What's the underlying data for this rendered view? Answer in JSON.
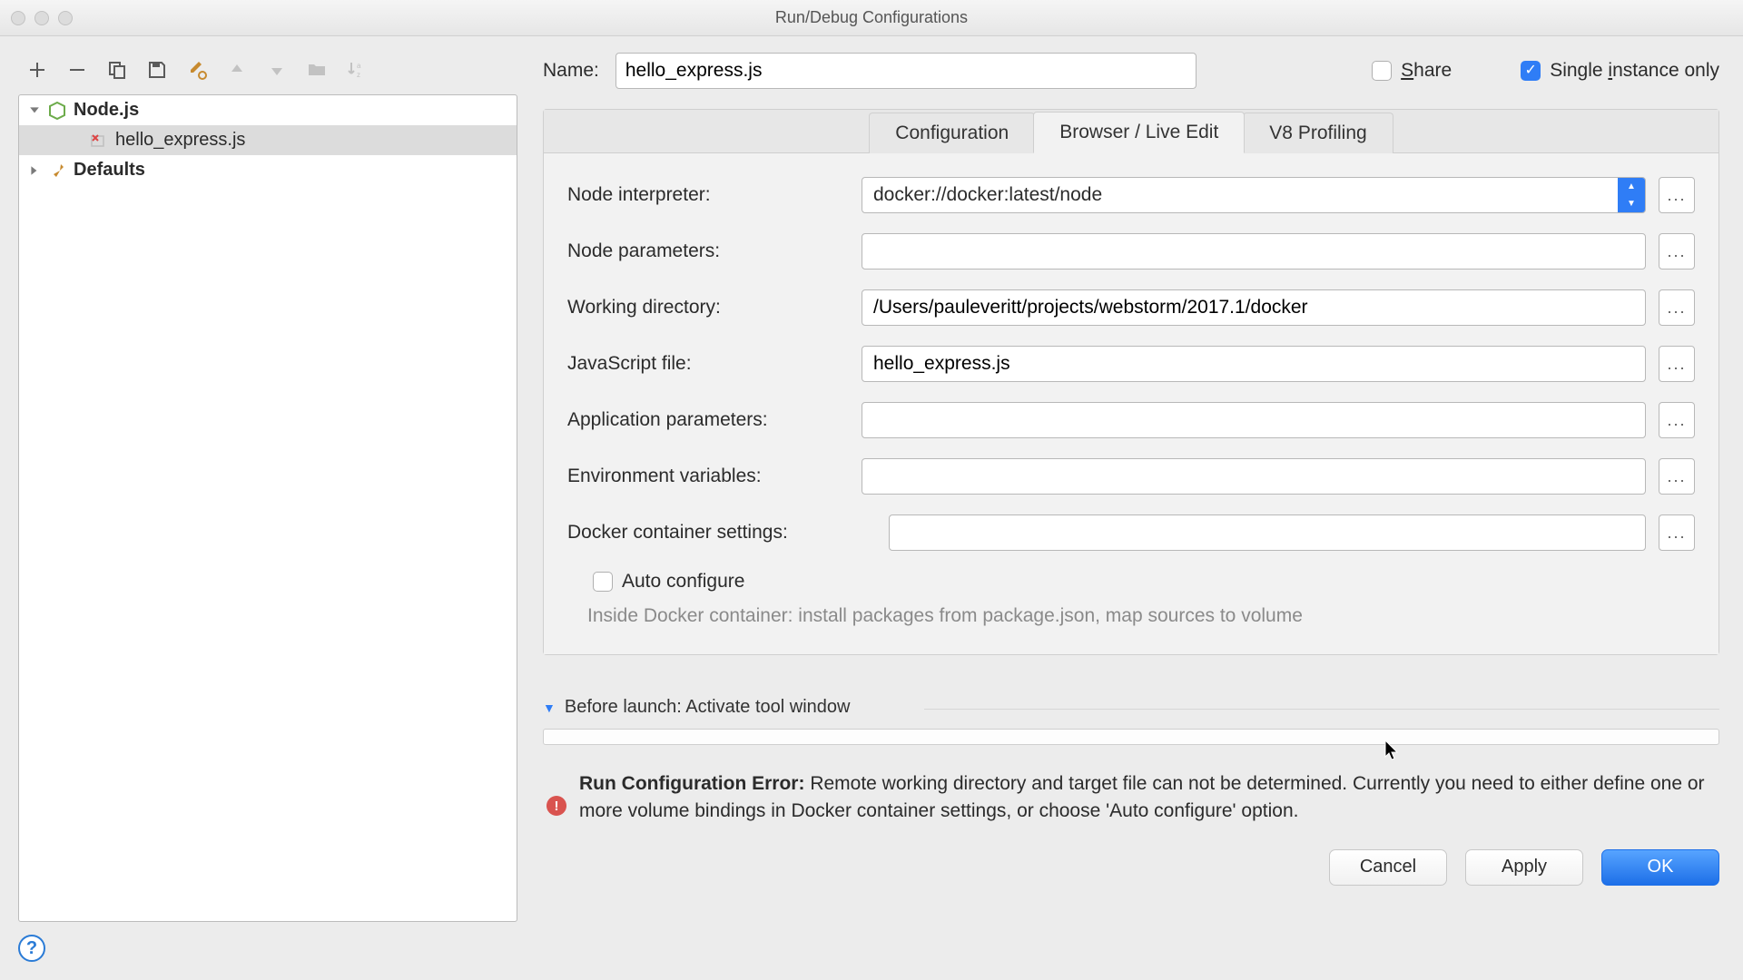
{
  "window": {
    "title": "Run/Debug Configurations"
  },
  "tree": {
    "nodejs_label": "Node.js",
    "item1": "hello_express.js",
    "defaults_label": "Defaults"
  },
  "header": {
    "name_label": "Name:",
    "name_value": "hello_express.js",
    "share_label_pre": "",
    "share_label_u": "S",
    "share_label_post": "hare",
    "single_label_pre": "Single ",
    "single_label_u": "i",
    "single_label_post": "nstance only"
  },
  "tabs": {
    "t1": "Configuration",
    "t2": "Browser / Live Edit",
    "t3": "V8 Profiling"
  },
  "form": {
    "node_interpreter_label": "Node interpreter:",
    "node_interpreter_value": "docker://docker:latest/node",
    "node_parameters_label": "Node parameters:",
    "node_parameters_value": "",
    "working_directory_label": "Working directory:",
    "working_directory_value": "/Users/pauleveritt/projects/webstorm/2017.1/docker",
    "javascript_file_label": "JavaScript file:",
    "javascript_file_value": "hello_express.js",
    "application_parameters_label": "Application parameters:",
    "application_parameters_value": "",
    "environment_variables_label": "Environment variables:",
    "environment_variables_value": "",
    "docker_settings_label": "Docker container settings:",
    "docker_settings_value": "",
    "auto_configure_label": "Auto configure",
    "hint": "Inside Docker container: install packages from package.json, map sources to volume"
  },
  "before_launch": {
    "label": "Before launch: Activate tool window"
  },
  "error": {
    "title": "Run Configuration Error:",
    "message": " Remote working directory and target file can not be determined. Currently you need to either define one or more volume bindings in Docker container settings, or choose 'Auto configure' option."
  },
  "buttons": {
    "cancel": "Cancel",
    "apply": "Apply",
    "ok": "OK"
  }
}
